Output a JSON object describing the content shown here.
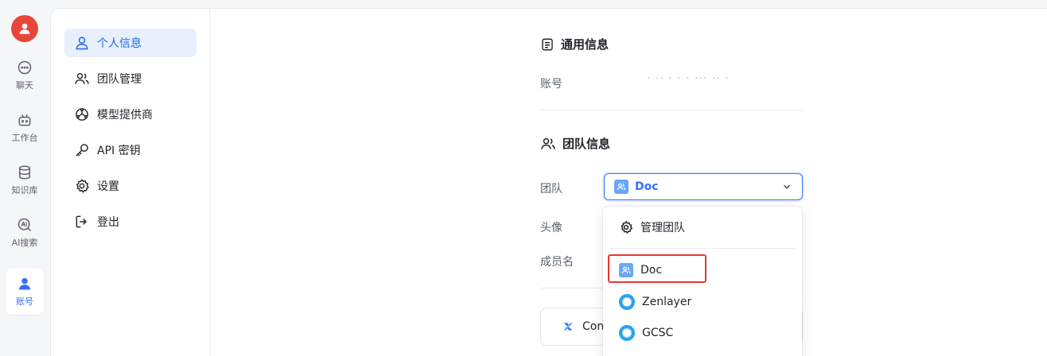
{
  "rail": {
    "items": [
      {
        "label": "聊天",
        "icon": "chat-bubble-icon"
      },
      {
        "label": "工作台",
        "icon": "robot-icon"
      },
      {
        "label": "知识库",
        "icon": "database-icon"
      },
      {
        "label": "AI搜索",
        "icon": "ai-search-icon"
      },
      {
        "label": "账号",
        "icon": "user-icon"
      }
    ]
  },
  "subnav": {
    "items": [
      {
        "label": "个人信息",
        "icon": "user-icon"
      },
      {
        "label": "团队管理",
        "icon": "team-icon"
      },
      {
        "label": "模型提供商",
        "icon": "model-icon"
      },
      {
        "label": "API 密钥",
        "icon": "key-icon"
      },
      {
        "label": "设置",
        "icon": "gear-icon"
      },
      {
        "label": "登出",
        "icon": "logout-icon"
      }
    ]
  },
  "general": {
    "title": "通用信息",
    "account_label": "账号",
    "account_value": "· ·· · · · ··· ·· ·"
  },
  "team": {
    "title": "团队信息",
    "team_label": "团队",
    "selected_team": "Doc",
    "avatar_label": "头像",
    "member_name_label": "成员名",
    "card_button_label": "Conf"
  },
  "dropdown": {
    "manage_label": "管理团队",
    "options": [
      "Doc",
      "Zenlayer",
      "GCSC"
    ]
  },
  "colors": {
    "accent": "#3370ff",
    "avatar": "#e8453c",
    "highlight": "#e53935"
  }
}
